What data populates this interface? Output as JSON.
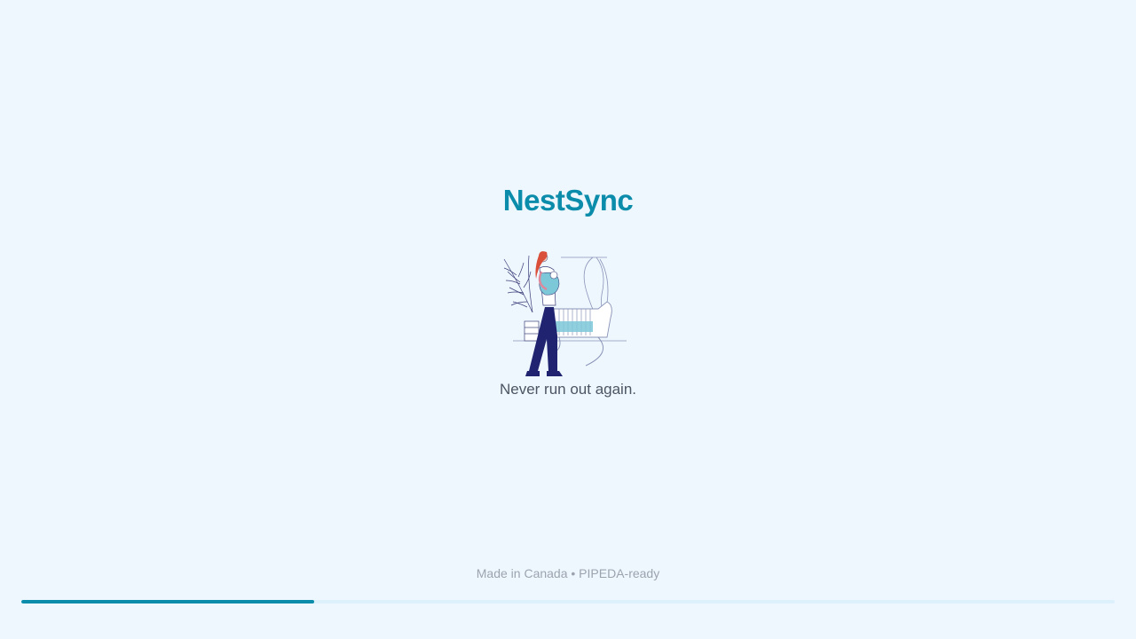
{
  "app": {
    "brand_name": "NestSync",
    "tagline": "Never run out again.",
    "footer_note": "Made in Canada • PIPEDA-ready"
  },
  "illustration": {
    "icon": "parent-holding-baby-near-crib-illustration"
  },
  "loading": {
    "progress_fraction": 0.268
  },
  "colors": {
    "background": "#eff7fe",
    "brand": "#0b8caa",
    "tagline_text": "#4b5563",
    "footer_text": "#9ca3af",
    "progress_track": "#dcf1fc",
    "progress_fill": "#0b8caa"
  }
}
